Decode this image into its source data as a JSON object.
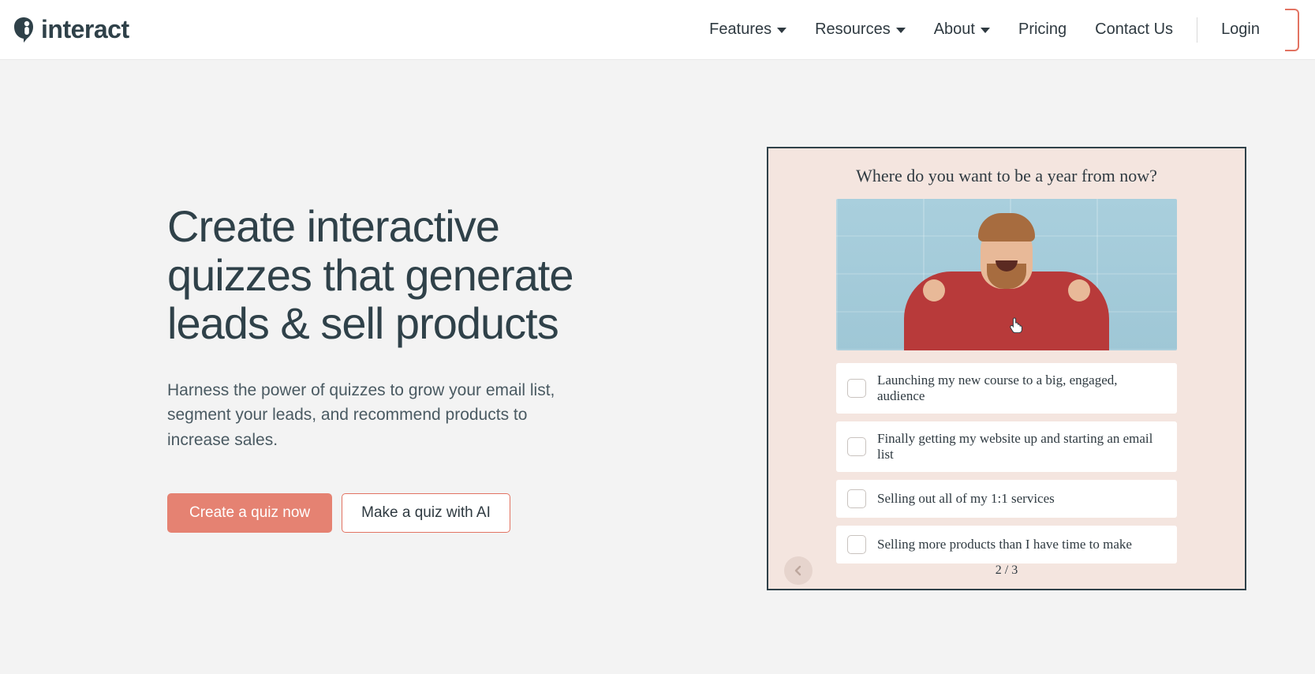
{
  "brand": {
    "name": "interact"
  },
  "nav": {
    "items": [
      {
        "label": "Features",
        "has_dropdown": true
      },
      {
        "label": "Resources",
        "has_dropdown": true
      },
      {
        "label": "About",
        "has_dropdown": true
      },
      {
        "label": "Pricing",
        "has_dropdown": false
      },
      {
        "label": "Contact Us",
        "has_dropdown": false
      }
    ],
    "login_label": "Login"
  },
  "hero": {
    "headline": "Create interactive quizzes that generate leads & sell products",
    "subhead": "Harness the power of quizzes to grow your email list, segment your leads, and recommend products to increase sales.",
    "primary_cta": "Create a quiz now",
    "secondary_cta": "Make a quiz with AI"
  },
  "quiz": {
    "question": "Where do you want to be a year from now?",
    "options": [
      "Launching my new course to a big, engaged, audience",
      "Finally getting my website up and starting an email list",
      "Selling out all of my 1:1 services",
      "Selling more products than I have time to make"
    ],
    "page_indicator": "2 / 3"
  },
  "colors": {
    "accent": "#e58272",
    "accent_border": "#e27362",
    "text_dark": "#2f4149",
    "quiz_bg": "#f4e5df"
  }
}
